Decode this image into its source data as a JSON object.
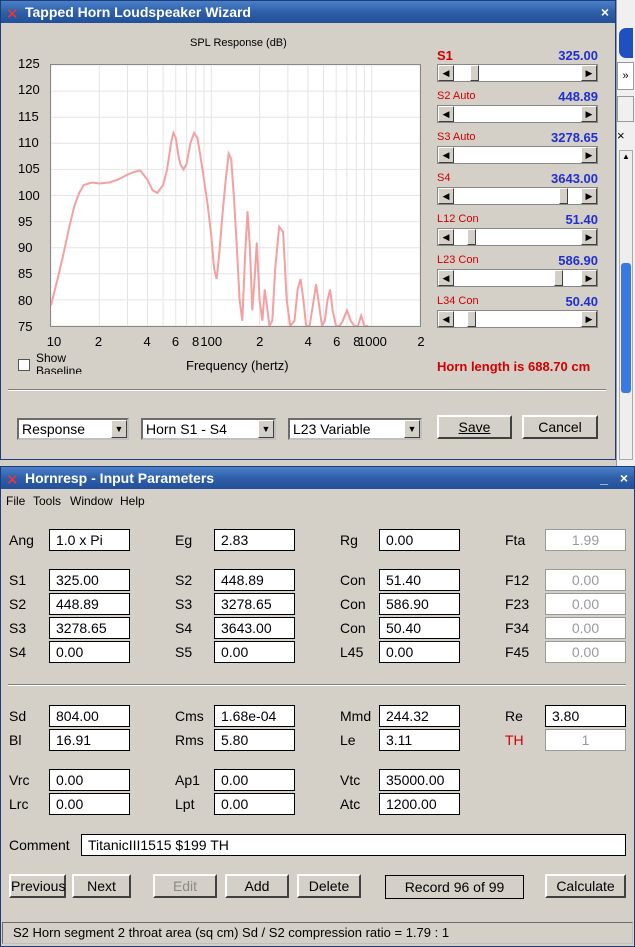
{
  "wizard": {
    "title": "Tapped Horn Loudspeaker Wizard",
    "close": "×",
    "chart_title": "SPL Response (dB)",
    "xlabel": "Frequency (hertz)",
    "show_baseline": "Show Baseline",
    "horn_length": "Horn length is 688.70 cm",
    "params": [
      {
        "label": "S1",
        "value": "325.00",
        "thumb": 0.13
      },
      {
        "label": "S2 Auto",
        "value": "448.89",
        "thumb": null
      },
      {
        "label": "S3 Auto",
        "value": "3278.65",
        "thumb": null
      },
      {
        "label": "S4",
        "value": "3643.00",
        "thumb": 0.9
      },
      {
        "label": "L12 Con",
        "value": "51.40",
        "thumb": 0.1
      },
      {
        "label": "L23 Con",
        "value": "586.90",
        "thumb": 0.85
      },
      {
        "label": "L34 Con",
        "value": "50.40",
        "thumb": 0.1
      }
    ],
    "combo_view": "Response",
    "combo_segment": "Horn S1 - S4",
    "combo_variable": "L23 Variable",
    "save": "Save",
    "cancel": "Cancel"
  },
  "chart_data": {
    "type": "line",
    "title": "SPL Response (dB)",
    "xlabel": "Frequency (hertz)",
    "ylabel": "",
    "xscale": "log",
    "xlim": [
      10,
      2000
    ],
    "ylim": [
      75,
      125
    ],
    "yticks": [
      "125",
      "120",
      "115",
      "110",
      "105",
      "100",
      "95",
      "90",
      "85",
      "80",
      "75"
    ],
    "xticks": [
      {
        "v": 10,
        "t": "10"
      },
      {
        "v": 20,
        "t": "2"
      },
      {
        "v": 40,
        "t": "4"
      },
      {
        "v": 60,
        "t": "6"
      },
      {
        "v": 80,
        "t": "8"
      },
      {
        "v": 100,
        "t": "100"
      },
      {
        "v": 200,
        "t": "2"
      },
      {
        "v": 400,
        "t": "4"
      },
      {
        "v": 600,
        "t": "6"
      },
      {
        "v": 800,
        "t": "8"
      },
      {
        "v": 1000,
        "t": "1000"
      },
      {
        "v": 2000,
        "t": "2"
      }
    ],
    "grid": true,
    "color": "#f4a0a0",
    "x": [
      10,
      11,
      12,
      13,
      14,
      15,
      16,
      18,
      20,
      23,
      26,
      30,
      33,
      36,
      40,
      43,
      46,
      50,
      53,
      56,
      58,
      60,
      62,
      64,
      67,
      70,
      74,
      78,
      82,
      85,
      88,
      91,
      95,
      100,
      104,
      108,
      112,
      117,
      122,
      128,
      133,
      138,
      143,
      150,
      156,
      162,
      168,
      174,
      180,
      186,
      192,
      200,
      208,
      215,
      222,
      230,
      240,
      250,
      265,
      280,
      295,
      310,
      330,
      345,
      360,
      375,
      390,
      410,
      430,
      450,
      470,
      490,
      510,
      530,
      550,
      570,
      600,
      630,
      660,
      700,
      740,
      780,
      820,
      860,
      900,
      950
    ],
    "y": [
      79,
      84,
      89,
      94,
      98,
      100.5,
      102,
      102.5,
      102.3,
      102.5,
      103,
      104,
      104.5,
      104.8,
      103,
      101,
      100.5,
      102,
      105,
      110,
      112,
      111,
      108,
      106,
      105,
      106,
      110,
      112,
      111,
      108,
      105,
      102,
      98,
      92,
      86,
      84,
      89,
      96,
      102,
      108,
      107,
      100,
      92,
      80,
      76,
      88,
      97,
      90,
      78,
      84,
      91,
      80,
      76,
      82,
      79,
      75,
      76,
      86,
      94,
      93,
      80,
      75,
      76,
      82,
      84,
      80,
      75,
      75,
      79,
      83,
      79,
      75,
      76,
      80,
      82,
      78,
      75,
      75,
      76,
      78,
      76,
      75,
      75,
      77,
      75,
      75
    ]
  },
  "params_window": {
    "title": "Hornresp - Input Parameters",
    "minimize": "_",
    "close": "×",
    "menu": [
      "File",
      "Tools",
      "Window",
      "Help"
    ],
    "row1": [
      {
        "label": "Ang",
        "value": "1.0 x Pi"
      },
      {
        "label": "Eg",
        "value": "2.83"
      },
      {
        "label": "Rg",
        "value": "0.00"
      },
      {
        "label": "Fta",
        "value": "1.99"
      }
    ],
    "horn": [
      [
        {
          "label": "S1",
          "value": "325.00"
        },
        {
          "label": "S2",
          "value": "448.89"
        },
        {
          "label": "Con",
          "value": "51.40"
        },
        {
          "label": "F12",
          "value": "0.00"
        }
      ],
      [
        {
          "label": "S2",
          "value": "448.89"
        },
        {
          "label": "S3",
          "value": "3278.65"
        },
        {
          "label": "Con",
          "value": "586.90"
        },
        {
          "label": "F23",
          "value": "0.00"
        }
      ],
      [
        {
          "label": "S3",
          "value": "3278.65"
        },
        {
          "label": "S4",
          "value": "3643.00"
        },
        {
          "label": "Con",
          "value": "50.40"
        },
        {
          "label": "F34",
          "value": "0.00"
        }
      ],
      [
        {
          "label": "S4",
          "value": "0.00"
        },
        {
          "label": "S5",
          "value": "0.00"
        },
        {
          "label": "L45",
          "value": "0.00"
        },
        {
          "label": "F45",
          "value": "0.00"
        }
      ]
    ],
    "driver": [
      [
        {
          "label": "Sd",
          "value": "804.00"
        },
        {
          "label": "Cms",
          "value": "1.68e-04"
        },
        {
          "label": "Mmd",
          "value": "244.32"
        },
        {
          "label": "Re",
          "value": "3.80"
        }
      ],
      [
        {
          "label": "Bl",
          "value": "16.91"
        },
        {
          "label": "Rms",
          "value": "5.80"
        },
        {
          "label": "Le",
          "value": "3.11"
        },
        {
          "label": "TH",
          "value": "1"
        }
      ]
    ],
    "chamber": [
      [
        {
          "label": "Vrc",
          "value": "0.00"
        },
        {
          "label": "Ap1",
          "value": "0.00"
        },
        {
          "label": "Vtc",
          "value": "35000.00"
        }
      ],
      [
        {
          "label": "Lrc",
          "value": "0.00"
        },
        {
          "label": "Lpt",
          "value": "0.00"
        },
        {
          "label": "Atc",
          "value": "1200.00"
        }
      ]
    ],
    "comment_label": "Comment",
    "comment": "TitanicIII1515 $199 TH",
    "buttons": {
      "previous": "Previous",
      "next": "Next",
      "edit": "Edit",
      "add": "Add",
      "delete": "Delete",
      "calculate": "Calculate"
    },
    "record": "Record 96 of 99",
    "status": "S2   Horn segment 2 throat area  (sq cm)   Sd / S2 compression ratio = 1.79 : 1"
  },
  "colors": {
    "title_bar": "#2e5fa8",
    "accent_red": "#d00000",
    "value_blue": "#2030d0",
    "curve": "#f4a0a0"
  }
}
